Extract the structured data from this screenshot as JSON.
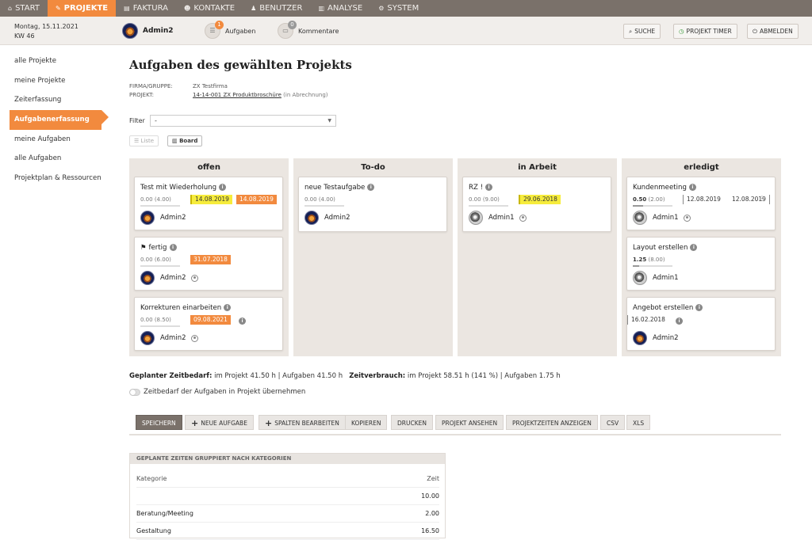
{
  "nav": [
    {
      "label": "START",
      "icon": "home-icon",
      "glyph": "⌂"
    },
    {
      "label": "PROJEKTE",
      "icon": "pencil-icon",
      "glyph": "✎",
      "active": true
    },
    {
      "label": "FAKTURA",
      "icon": "document-icon",
      "glyph": "▤"
    },
    {
      "label": "KONTAKTE",
      "icon": "contacts-icon",
      "glyph": "☻"
    },
    {
      "label": "BENUTZER",
      "icon": "user-icon",
      "glyph": "♟"
    },
    {
      "label": "ANALYSE",
      "icon": "chart-icon",
      "glyph": "▥"
    },
    {
      "label": "SYSTEM",
      "icon": "gear-icon",
      "glyph": "⚙"
    }
  ],
  "header": {
    "date": "Montag, 15.11.2021",
    "week": "KW 46",
    "user": "Admin2",
    "tasks_count": "1",
    "tasks_label": "Aufgaben",
    "comments_count": "0",
    "comments_label": "Kommentare",
    "search": "SUCHE",
    "timer": "PROJEKT TIMER",
    "logout": "ABMELDEN"
  },
  "sidebar": [
    "alle Projekte",
    "meine Projekte",
    "Zeiterfassung",
    "Aufgabenerfassung",
    "meine Aufgaben",
    "alle Aufgaben",
    "Projektplan & Ressourcen"
  ],
  "page": {
    "title": "Aufgaben des gewählten Projekts",
    "firm_label": "FIRMA/GRUPPE:",
    "firm_value": "ZX Testfirma",
    "project_label": "PROJEKT:",
    "project_value": "14-14-001 ZX Produktbroschüre",
    "project_hint": "(in Abrechnung)",
    "filter_label": "Filter",
    "filter_value": "-",
    "view_list": "Liste",
    "view_board": "Board"
  },
  "board": [
    {
      "title": "offen",
      "cards": [
        {
          "name": "Test mit Wiederholung",
          "hours": "0.00",
          "planned": "(4.00)",
          "progress": 0,
          "tags": [
            {
              "t": "14.08.2019",
              "c": "y"
            },
            {
              "t": "14.08.2019",
              "c": "o"
            }
          ],
          "user": "Admin2",
          "photo": false,
          "person": false
        },
        {
          "name": "fertig",
          "flag": true,
          "hours": "0.00",
          "planned": "(6.00)",
          "progress": 0,
          "tags": [
            {
              "t": "31.07.2018",
              "c": "o"
            }
          ],
          "user": "Admin2",
          "photo": false,
          "person": true
        },
        {
          "name": "Korrekturen einarbeiten",
          "hours": "0.00",
          "planned": "(8.50)",
          "progress": 0,
          "tags": [
            {
              "t": "09.08.2021",
              "c": "o"
            }
          ],
          "tag_info": true,
          "user": "Admin2",
          "photo": false,
          "person": true
        }
      ]
    },
    {
      "title": "To-do",
      "cards": [
        {
          "name": "neue Testaufgabe",
          "hours": "0.00",
          "planned": "(4.00)",
          "progress": 0,
          "tags": [],
          "user": "Admin2",
          "photo": false,
          "person": false
        }
      ]
    },
    {
      "title": "in Arbeit",
      "cards": [
        {
          "name": "RZ !",
          "hours": "0.00",
          "planned": "(9.00)",
          "progress": 0,
          "tags": [
            {
              "t": "29.06.2018",
              "c": "y"
            }
          ],
          "user": "Admin1",
          "photo": true,
          "person": true
        }
      ]
    },
    {
      "title": "erledigt",
      "cards": [
        {
          "name": "Kundenmeeting",
          "hours": "0.50",
          "planned": "(2.00)",
          "progress": 0.25,
          "bold": true,
          "tags": [
            {
              "t": "12.08.2019",
              "c": "plain"
            },
            {
              "t": "12.08.2019",
              "c": "end"
            }
          ],
          "more": "⋮",
          "user": "Admin1",
          "photo": true,
          "person": true
        },
        {
          "name": "Layout erstellen",
          "hours": "1.25",
          "planned": "(8.00)",
          "progress": 0.16,
          "bold": true,
          "tags": [],
          "user": "Admin1",
          "photo": true,
          "person": false
        },
        {
          "name": "Angebot erstellen",
          "hours": "",
          "planned": "",
          "progress": 0,
          "tags": [
            {
              "t": "16.02.2018",
              "c": "plain"
            }
          ],
          "tag_info": true,
          "user": "Admin2",
          "photo": false,
          "person": false
        }
      ]
    }
  ],
  "summary": {
    "plan_label": "Geplanter Zeitbedarf:",
    "plan_value": " im Projekt 41.50 h | Aufgaben 41.50 h",
    "use_label": "Zeitverbrauch:",
    "use_value": " im Projekt 58.51 h (141 %) | Aufgaben 1.75 h",
    "toggle": "Zeitbedarf der Aufgaben in Projekt übernehmen"
  },
  "actions": [
    "SPEICHERN",
    "NEUE AUFGABE",
    "SPALTEN BEARBEITEN",
    "KOPIEREN",
    "DRUCKEN",
    "PROJEKT ANSEHEN",
    "PROJEKTZEITEN ANZEIGEN",
    "CSV",
    "XLS"
  ],
  "categories": {
    "title": "GEPLANTE ZEITEN GRUPPIERT NACH KATEGORIEN",
    "col1": "Kategorie",
    "col2": "Zeit",
    "rows": [
      {
        "name": "",
        "value": "10.00"
      },
      {
        "name": "Beratung/Meeting",
        "value": "2.00"
      },
      {
        "name": "Gestaltung",
        "value": "16.50"
      }
    ]
  }
}
